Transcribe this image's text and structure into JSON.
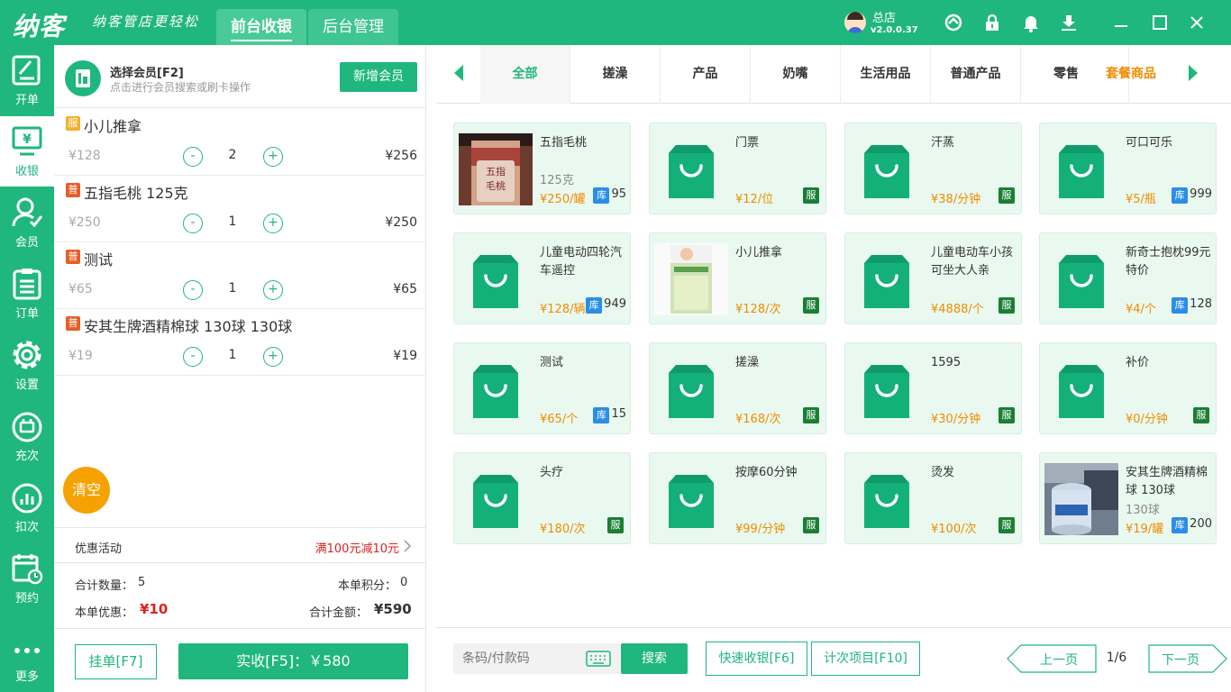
{
  "app": {
    "logo": "纳客",
    "slogan": "纳客管店更轻松",
    "tabs": [
      "前台收银",
      "后台管理"
    ],
    "store_name": "总店",
    "version": "v2.0.0.37"
  },
  "sidebar": [
    {
      "label": "开单",
      "icon": "edit-icon"
    },
    {
      "label": "收银",
      "icon": "cashier-icon"
    },
    {
      "label": "会员",
      "icon": "member-icon"
    },
    {
      "label": "订单",
      "icon": "order-icon"
    },
    {
      "label": "设置",
      "icon": "gear-icon"
    },
    {
      "label": "充次",
      "icon": "recharge-icon"
    },
    {
      "label": "扣次",
      "icon": "deduct-icon"
    },
    {
      "label": "预约",
      "icon": "calendar-icon"
    },
    {
      "label": "更多",
      "icon": "more-icon"
    }
  ],
  "member": {
    "title": "选择会员[F2]",
    "subtitle": "点击进行会员搜索或刷卡操作",
    "add_button": "新增会员"
  },
  "cart": {
    "items": [
      {
        "tag": "服",
        "name": "小儿推拿",
        "price": "¥128",
        "qty": "2",
        "total": "¥256"
      },
      {
        "tag": "普",
        "name": "五指毛桃 125克",
        "price": "¥250",
        "qty": "1",
        "total": "¥250"
      },
      {
        "tag": "普",
        "name": "测试",
        "price": "¥65",
        "qty": "1",
        "total": "¥65"
      },
      {
        "tag": "普",
        "name": "安其生牌酒精棉球 130球 130球",
        "price": "¥19",
        "qty": "1",
        "total": "¥19"
      }
    ],
    "minus": "-",
    "plus": "+",
    "clear_button": "清空",
    "promo_label": "优惠活动",
    "promo_value": "满100元减10元",
    "total_qty_label": "合计数量：",
    "total_qty": "5",
    "points_label": "本单积分：",
    "points": "0",
    "discount_label": "本单优惠：",
    "discount": "¥10",
    "amount_label": "合计金额：",
    "amount": "¥590",
    "hold_button": "挂单[F7]",
    "pay_button": "实收[F5]：￥580"
  },
  "categories": [
    "全部",
    "搓澡",
    "产品",
    "奶嘴",
    "生活用品",
    "普通产品",
    "零售"
  ],
  "category_extra": "套餐商品",
  "products": [
    {
      "name": "五指毛桃",
      "spec": "125克",
      "price": "¥250/罐",
      "badge": "stock",
      "ku": "库",
      "stock": "95",
      "img": "photo-jar"
    },
    {
      "name": "门票",
      "spec": "",
      "price": "¥12/位",
      "badge": "fu",
      "fu": "服",
      "img": "bag"
    },
    {
      "name": "汗蒸",
      "spec": "",
      "price": "¥38/分钟",
      "badge": "fu",
      "fu": "服",
      "img": "bag"
    },
    {
      "name": "可口可乐",
      "spec": "",
      "price": "¥5/瓶",
      "badge": "stock",
      "ku": "库",
      "stock": "999",
      "img": "bag"
    },
    {
      "name": "儿童电动四轮汽车遥控",
      "spec": "",
      "price": "¥128/辆",
      "badge": "stock",
      "ku": "库",
      "stock": "949",
      "img": "bag"
    },
    {
      "name": "小儿推拿",
      "spec": "",
      "price": "¥128/次",
      "badge": "fu",
      "fu": "服",
      "img": "photo-box"
    },
    {
      "name": "儿童电动车小孩可坐大人亲",
      "spec": "",
      "price": "¥4888/个",
      "badge": "fu",
      "fu": "服",
      "img": "bag"
    },
    {
      "name": "新奇士抱枕99元特价",
      "spec": "",
      "price": "¥4/个",
      "badge": "stock",
      "ku": "库",
      "stock": "128",
      "img": "bag"
    },
    {
      "name": "测试",
      "spec": "",
      "price": "¥65/个",
      "badge": "stock",
      "ku": "库",
      "stock": "15",
      "img": "bag"
    },
    {
      "name": "搓澡",
      "spec": "",
      "price": "¥168/次",
      "badge": "fu",
      "fu": "服",
      "img": "bag"
    },
    {
      "name": "1595",
      "spec": "",
      "price": "¥30/分钟",
      "badge": "fu",
      "fu": "服",
      "img": "bag"
    },
    {
      "name": "补价",
      "spec": "",
      "price": "¥0/分钟",
      "badge": "fu",
      "fu": "服",
      "img": "bag"
    },
    {
      "name": "头疗",
      "spec": "",
      "price": "¥180/次",
      "badge": "fu",
      "fu": "服",
      "img": "bag"
    },
    {
      "name": "按摩60分钟",
      "spec": "",
      "price": "¥99/分钟",
      "badge": "fu",
      "fu": "服",
      "img": "bag"
    },
    {
      "name": "烫发",
      "spec": "",
      "price": "¥100/次",
      "badge": "fu",
      "fu": "服",
      "img": "bag"
    },
    {
      "name": "安其生牌酒精棉球 130球",
      "spec": "130球",
      "price": "¥19/罐",
      "badge": "stock",
      "ku": "库",
      "stock": "200",
      "img": "photo-cotton"
    }
  ],
  "footer": {
    "search_placeholder": "条码/付款码",
    "search_button": "搜索",
    "quick_cashier": "快速收银[F6]",
    "count_items": "计次项目[F10]",
    "prev": "上一页",
    "page": "1/6",
    "next": "下一页"
  },
  "colors": {
    "primary": "#1fb77d",
    "price": "#f08c00",
    "discount": "#e02020",
    "clear": "#f5a200"
  }
}
